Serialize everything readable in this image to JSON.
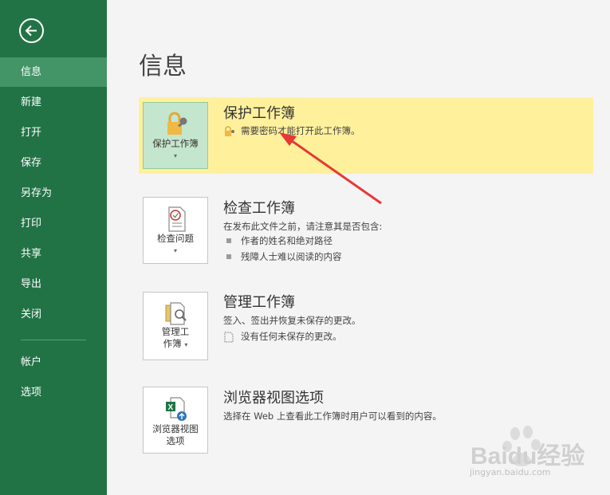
{
  "back": {
    "icon": "back-arrow-icon"
  },
  "nav": {
    "items": [
      {
        "label": "信息",
        "active": true
      },
      {
        "label": "新建"
      },
      {
        "label": "打开"
      },
      {
        "label": "保存"
      },
      {
        "label": "另存为"
      },
      {
        "label": "打印"
      },
      {
        "label": "共享"
      },
      {
        "label": "导出"
      },
      {
        "label": "关闭"
      }
    ],
    "bottom": [
      {
        "label": "帐户"
      },
      {
        "label": "选项"
      }
    ]
  },
  "page_title": "信息",
  "sections": {
    "protect": {
      "tile_label": "保护工作簿",
      "title": "保护工作簿",
      "desc": "需要密码才能打开此工作簿。",
      "icon": "lock-key-icon",
      "highlight_color": "#fff19c"
    },
    "inspect": {
      "tile_label": "检查问题",
      "title": "检查工作簿",
      "desc": "在发布此文件之前，请注意其是否包含:",
      "bullets": [
        "作者的姓名和绝对路径",
        "残障人士难以阅读的内容"
      ],
      "icon": "inspect-document-icon"
    },
    "manage": {
      "tile_label_1": "管理工",
      "tile_label_2": "作簿",
      "title": "管理工作簿",
      "desc": "签入、签出并恢复未保存的更改。",
      "note": "没有任何未保存的更改。",
      "icon": "manage-workbook-icon"
    },
    "browser": {
      "tile_label_1": "浏览器视图",
      "tile_label_2": "选项",
      "title": "浏览器视图选项",
      "desc": "选择在 Web 上查看此工作簿时用户可以看到的内容。",
      "icon": "excel-web-icon"
    }
  },
  "watermark": {
    "brand": "Baidu经验",
    "url": "jingyan.baidu.com"
  },
  "colors": {
    "sidebar": "#217346",
    "sidebar_active": "#439467",
    "annotation_arrow": "#e53935"
  }
}
